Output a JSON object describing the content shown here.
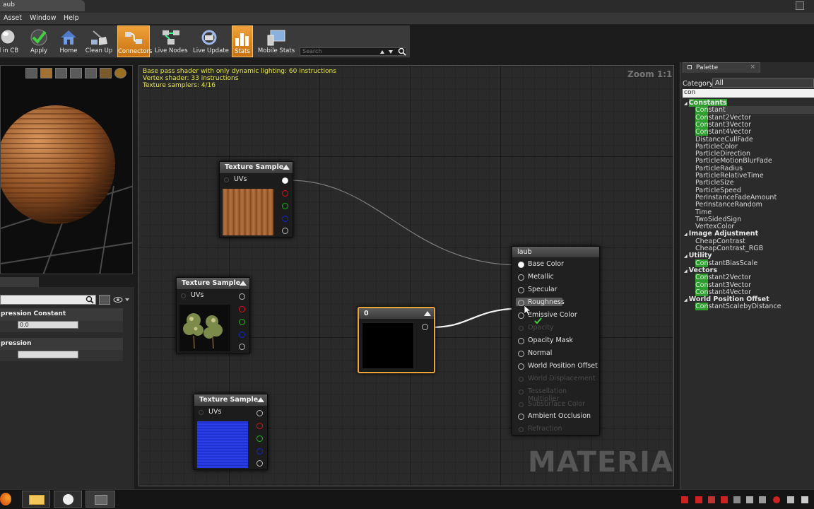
{
  "window": {
    "tab_title": "aub"
  },
  "menu": [
    "Asset",
    "Window",
    "Help"
  ],
  "toolbar": {
    "buttons": [
      {
        "label": "d in CB",
        "icon": "sphere-icon"
      },
      {
        "label": "Apply",
        "icon": "checkmark-icon"
      },
      {
        "label": "Home",
        "icon": "home-icon"
      },
      {
        "label": "Clean Up",
        "icon": "broom-icon"
      },
      {
        "label": "Connectors",
        "icon": "connectors-icon",
        "active": true
      },
      {
        "label": "Live Nodes",
        "icon": "live-nodes-icon"
      },
      {
        "label": "Live Update",
        "icon": "live-update-icon"
      },
      {
        "label": "Stats",
        "icon": "stats-icon",
        "active": true
      },
      {
        "label": "Mobile Stats",
        "icon": "mobile-stats-icon"
      }
    ],
    "search_placeholder": "Search"
  },
  "details": {
    "sections": [
      {
        "title": "pression Constant",
        "field_value": "0.0"
      },
      {
        "title": "pression",
        "field_value": ""
      }
    ]
  },
  "graph": {
    "stats_lines": [
      "Base pass shader with only dynamic lighting: 60 instructions",
      "Vertex shader: 33 instructions",
      "Texture samplers: 4/16"
    ],
    "zoom": "Zoom 1:1",
    "watermark": "MATERIAL",
    "texture_nodes": [
      {
        "title": "Texture Sample",
        "input": "UVs",
        "preview": "wood"
      },
      {
        "title": "Texture Sample",
        "input": "UVs",
        "preview": "trees"
      },
      {
        "title": "Texture Sample",
        "input": "UVs",
        "preview": "bricks"
      }
    ],
    "constant_node": {
      "title": "0"
    },
    "material_node": {
      "title": "laub",
      "inputs": [
        {
          "label": "Base Color",
          "enabled": true
        },
        {
          "label": "Metallic",
          "enabled": true
        },
        {
          "label": "Specular",
          "enabled": true
        },
        {
          "label": "Roughness",
          "enabled": true,
          "highlighted": true
        },
        {
          "label": "Emissive Color",
          "enabled": true
        },
        {
          "label": "Opacity",
          "enabled": false
        },
        {
          "label": "Opacity Mask",
          "enabled": true
        },
        {
          "label": "Normal",
          "enabled": true
        },
        {
          "label": "World Position Offset",
          "enabled": true
        },
        {
          "label": "World Displacement",
          "enabled": false
        },
        {
          "label": "Tessellation Multiplier",
          "enabled": false
        },
        {
          "label": "Subsurface Color",
          "enabled": false
        },
        {
          "label": "Ambient Occlusion",
          "enabled": true
        },
        {
          "label": "Refraction",
          "enabled": false
        }
      ]
    }
  },
  "palette": {
    "tab": "Palette",
    "category_label": "Category:",
    "category_value": "All",
    "filter": "con",
    "groups": [
      {
        "name": "Constants",
        "items": [
          {
            "hl": "Con",
            "rest": "stant"
          },
          {
            "hl": "Con",
            "rest": "stant2Vector"
          },
          {
            "hl": "Con",
            "rest": "stant3Vector"
          },
          {
            "hl": "Con",
            "rest": "stant4Vector"
          },
          {
            "hl": "",
            "rest": "DistanceCullFade"
          },
          {
            "hl": "",
            "rest": "ParticleColor"
          },
          {
            "hl": "",
            "rest": "ParticleDirection"
          },
          {
            "hl": "",
            "rest": "ParticleMotionBlurFade"
          },
          {
            "hl": "",
            "rest": "ParticleRadius"
          },
          {
            "hl": "",
            "rest": "ParticleRelativeTime"
          },
          {
            "hl": "",
            "rest": "ParticleSize"
          },
          {
            "hl": "",
            "rest": "ParticleSpeed"
          },
          {
            "hl": "",
            "rest": "PerInstanceFadeAmount"
          },
          {
            "hl": "",
            "rest": "PerInstanceRandom"
          },
          {
            "hl": "",
            "rest": "Time"
          },
          {
            "hl": "",
            "rest": "TwoSidedSign"
          },
          {
            "hl": "",
            "rest": "VertexColor"
          }
        ]
      },
      {
        "name": "Image Adjustment",
        "items": [
          {
            "hl": "",
            "rest": "CheapContrast"
          },
          {
            "hl": "",
            "rest": "CheapContrast_RGB"
          }
        ]
      },
      {
        "name": "Utility",
        "items": [
          {
            "hl": "Con",
            "rest": "stantBiasScale"
          }
        ]
      },
      {
        "name": "Vectors",
        "items": [
          {
            "hl": "Con",
            "rest": "stant2Vector"
          },
          {
            "hl": "Con",
            "rest": "stant3Vector"
          },
          {
            "hl": "Con",
            "rest": "stant4Vector"
          }
        ]
      },
      {
        "name": "World Position Offset",
        "items": [
          {
            "hl": "Con",
            "rest": "stantScalebyDistance"
          }
        ]
      }
    ]
  },
  "colors": {
    "accent_orange": "#f0a23a",
    "highlight_green": "#2f9c2f",
    "stats_yellow": "#e7e54c"
  }
}
